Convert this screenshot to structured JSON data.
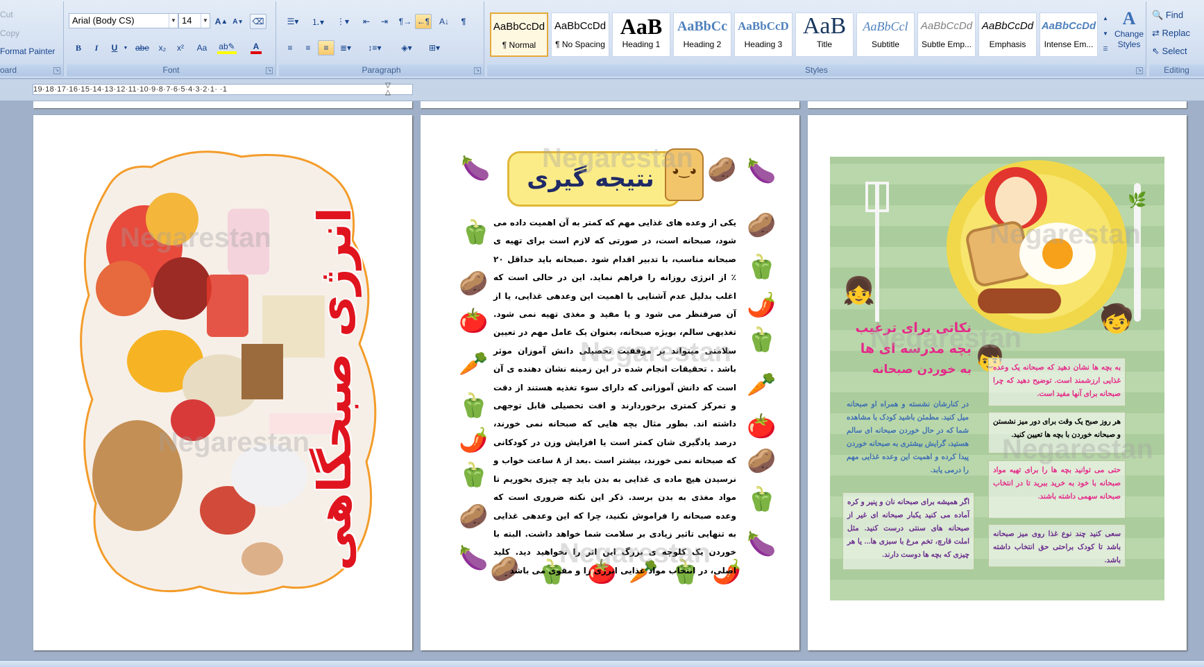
{
  "clipboard": {
    "cut": "Cut",
    "copy": "Copy",
    "format_painter": "Format Painter",
    "label": "oard"
  },
  "font": {
    "family": "Arial (Body CS)",
    "size": "14",
    "label": "Font",
    "bold": "B",
    "italic": "I",
    "underline": "U",
    "strike": "abe",
    "subscript": "x₂",
    "superscript": "x²",
    "change_case": "Aa",
    "font_color": "A"
  },
  "paragraph": {
    "label": "Paragraph"
  },
  "styles": {
    "label": "Styles",
    "items": [
      {
        "sample": "AaBbCcDd",
        "name": "¶ Normal"
      },
      {
        "sample": "AaBbCcDd",
        "name": "¶ No Spacing"
      },
      {
        "sample": "AaB",
        "name": "Heading 1"
      },
      {
        "sample": "AaBbCc",
        "name": "Heading 2"
      },
      {
        "sample": "AaBbCcD",
        "name": "Heading 3"
      },
      {
        "sample": "AaB",
        "name": "Title"
      },
      {
        "sample": "AaBbCcl",
        "name": "Subtitle"
      },
      {
        "sample": "AaBbCcDd",
        "name": "Subtle Emp..."
      },
      {
        "sample": "AaBbCcDd",
        "name": "Emphasis"
      },
      {
        "sample": "AaBbCcDd",
        "name": "Intense Em..."
      }
    ],
    "change_styles": "Change Styles"
  },
  "editing": {
    "label": "Editing",
    "find": "Find",
    "replace": "Replac",
    "select": "Select"
  },
  "ruler": {
    "ticks": "19·18·17·16·15·14·13·12·11·10·9·8·7·6·5·4·3·2·1·  ·1"
  },
  "watermark": "Negarestan",
  "page1": {
    "title": "انرژی صبحگاهی"
  },
  "page2": {
    "title": "نتیجه گیری",
    "body": "یکی از وعده های غذایی مهم که کمتر به آن اهمیت داده می شود، صبحانه است، در صورتی که لازم است برای تهیه ی صبحانه مناسب، با تدبیر اقدام شود .صبحانه باید حداقل ۲۰ ٪ از انرژی روزانه را فراهم نماید. این در حالی است که اغلب بدلیل عدم آشنایی با اهمیت این وعدهی غذایی، یا از آن صرفنظر می شود و یا مفید و مغذی تهیه نمی شود. تغذیهی سالم، بویژه صبحانه، بعنوان یک عامل مهم در تعیین سلامتی میتواند بر موفقیت تحصیلی دانش آموزان موثر باشد . تحقیقات انجام شده در این زمینه نشان دهنده ی آن است که دانش آموزانی که دارای سوء تغذیه هستند از دقت و تمرکز کمتری برخوردارند و افت تحصیلی قابل توجهی داشته اند. بطور مثال بچه هایی که صبحانه نمی خورند، درصد یادگیری شان کمتر است یا افزایش وزن در کودکانی که صبحانه نمی خورند، بیشتر است .بعد از ۸ ساعت خواب و نرسیدن هیچ ماده ی غذایی به بدن باید چه چیزی بخوریم تا مواد مغذی به بدن برسد. ذکر این نکته ضروری است که وعده صبحانه را فراموش نکنید، چرا که این وعدهی غذایی به تنهایی تاثیر زیادی بر سلامت شما خواهد داشت. البته با خوردن یک کلوچه ی بزرگ این اثر را نخواهید دید. کلید اصلی، در انتخاب مواد غذایی انرژی زا و مقوی می باشد"
  },
  "page3": {
    "title_line1": "نکاتی برای ترغیب",
    "title_line2": "بچه مدرسه ای ها",
    "title_line3": "به خوردن صبحانه",
    "tips_left": [
      "در کنارشان نشسته و همراه او صبحانه میل کنید. مطمئن باشید کودک با مشاهده شما که در حال خوردن صبحانه ای سالم هستید، گرایش بیشتری به صبحانه خوردن پیدا کرده و اهمیت این وعده غذایی مهم را درمی یابد.",
      "اگر همیشه برای صبحانه نان و پنیر و کره آماده می کنید یکبار صبحانه ای غیر از صبحانه های سنتی درست کنید. مثل املت قارچ، تخم مرغ با سبزی ها... یا هر چیزی که بچه ها دوست دارند."
    ],
    "tips_right": [
      "به بچه ها نشان دهید که صبحانه یک وعده غذایی ارزشمند است. توضیح دهید که چرا صبحانه برای آنها مفید است.",
      "هر روز صبح یک وقت برای دور میز نشستن و صبحانه خوردن با بچه ها تعیین کنید.",
      "حتی می توانید بچه ها را برای تهیه مواد صبحانه با خود به خرید ببرید تا در انتخاب صبحانه سهمی داشته باشند.",
      "سعی کنید چند نوع غذا روی میز صبحانه باشد تا کودک براحتی حق انتخاب داشته باشد."
    ]
  }
}
